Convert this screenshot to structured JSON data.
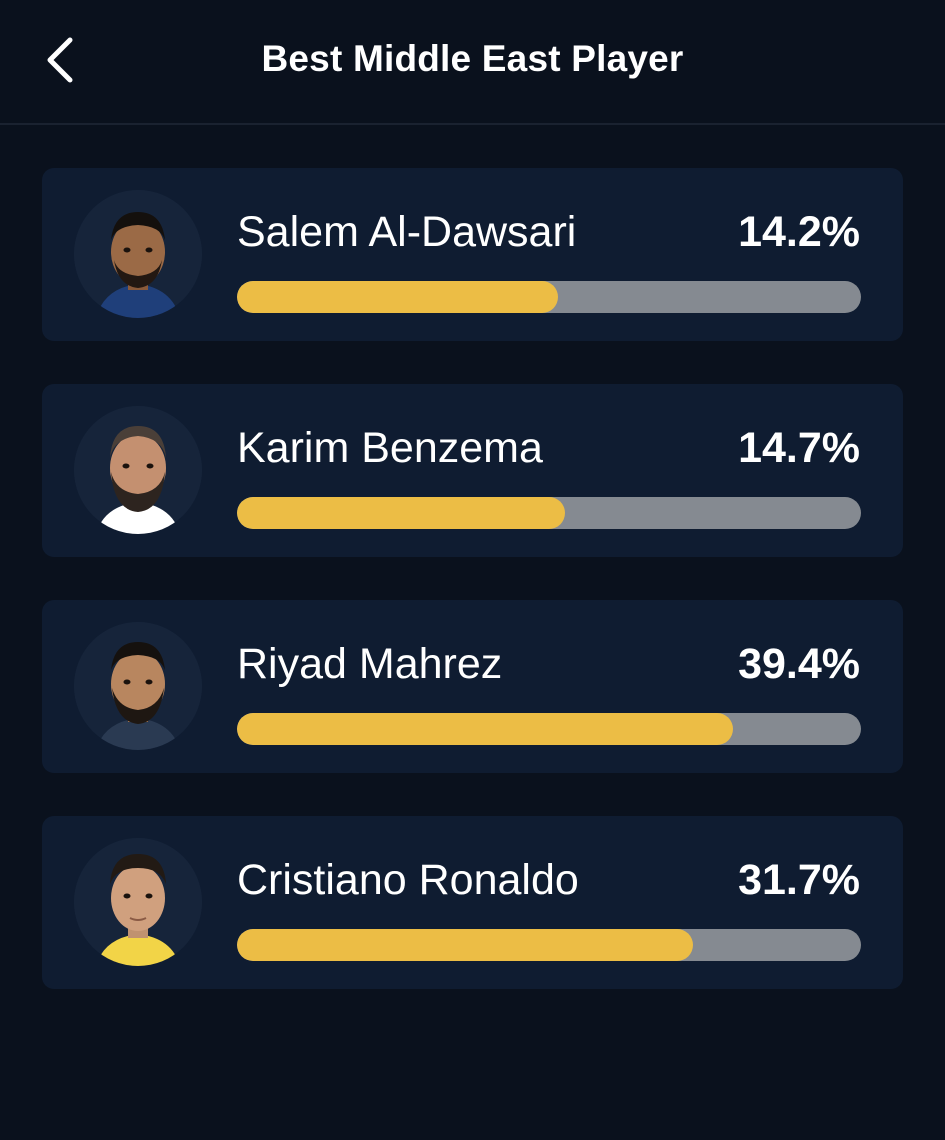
{
  "header": {
    "title": "Best Middle East Player",
    "back_icon": "chevron-left-icon"
  },
  "colors": {
    "background": "#0a111d",
    "card": "#0f1c31",
    "bar_fill": "#ecbd45",
    "bar_track": "#858a91",
    "text": "#ffffff"
  },
  "players": [
    {
      "name": "Salem Al-Dawsari",
      "percent_label": "14.2%",
      "bar_fill_fraction": 0.515
    },
    {
      "name": "Karim Benzema",
      "percent_label": "14.7%",
      "bar_fill_fraction": 0.525
    },
    {
      "name": "Riyad Mahrez",
      "percent_label": "39.4%",
      "bar_fill_fraction": 0.795
    },
    {
      "name": "Cristiano Ronaldo",
      "percent_label": "31.7%",
      "bar_fill_fraction": 0.73
    }
  ]
}
